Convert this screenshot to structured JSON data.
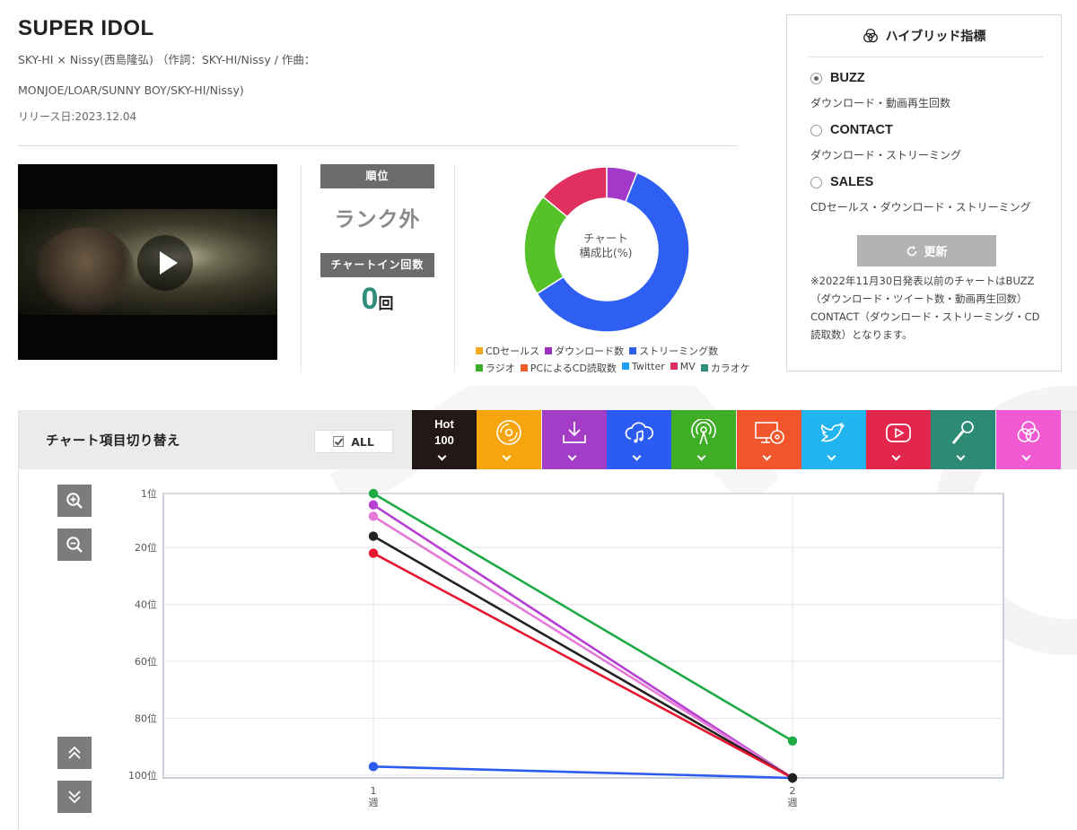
{
  "song": {
    "title": "SUPER IDOL",
    "credits_line1": "SKY-HI × Nissy(西島隆弘) （作詞：SKY-HI/Nissy / 作曲：",
    "credits_line2": "MONJOE/LOAR/SUNNY BOY/SKY-HI/Nissy)",
    "release": "リリース日:2023.12.04"
  },
  "stats": {
    "rank_label": "順位",
    "rank_value": "ランク外",
    "chartin_label": "チャートイン回数",
    "chartin_count": "0",
    "chartin_unit": "回"
  },
  "composition": {
    "center_line1": "チャート",
    "center_line2": "構成比(%)",
    "slices": [
      {
        "name": "ダウンロード数",
        "value": 6,
        "color": "#a23ac7"
      },
      {
        "name": "ストリーミング数",
        "value": 60,
        "color": "#2f5ff2"
      },
      {
        "name": "ラジオ",
        "value": 20,
        "color": "#55c22a"
      },
      {
        "name": "MV",
        "value": 14,
        "color": "#e0305f"
      }
    ],
    "legend_row1": [
      {
        "label": "CDセールス",
        "color": "#f5a623"
      },
      {
        "label": "ダウンロード数",
        "color": "#9b30c0"
      },
      {
        "label": "ストリーミング数",
        "color": "#2f5ff2"
      }
    ],
    "legend_row2": [
      {
        "label": "ラジオ",
        "color": "#3aaa2a"
      },
      {
        "label": "PCによるCD読取数",
        "color": "#f25a2a"
      },
      {
        "label": "Twitter",
        "color": "#1da1f2"
      },
      {
        "label": "MV",
        "color": "#e0305f"
      },
      {
        "label": "カラオケ",
        "color": "#2f8d79"
      }
    ]
  },
  "hybrid": {
    "heading": "ハイブリッド指標",
    "options": [
      {
        "label": "BUZZ",
        "desc": "ダウンロード・動画再生回数",
        "checked": true
      },
      {
        "label": "CONTACT",
        "desc": "ダウンロード・ストリーミング",
        "checked": false
      },
      {
        "label": "SALES",
        "desc": "CDセールス・ダウンロード・ストリーミング",
        "checked": false
      }
    ],
    "update_label": "更新",
    "note": "※2022年11月30日発表以前のチャートはBUZZ（ダウンロード・ツイート数・動画再生回数）CONTACT（ダウンロード・ストリーミング・CD読取数）となります。"
  },
  "switcher": {
    "label": "チャート項目切り替え",
    "all_label": "ALL",
    "tabs": [
      {
        "id": "hot100",
        "line1": "Hot",
        "line2": "100",
        "color": "#231815",
        "icon": "text"
      },
      {
        "id": "cd",
        "color": "#f6a50d",
        "icon": "cd-icon"
      },
      {
        "id": "download",
        "color": "#a33cc6",
        "icon": "download-icon"
      },
      {
        "id": "streaming",
        "color": "#2b5bf0",
        "icon": "cloud-music-icon"
      },
      {
        "id": "radio",
        "color": "#3fae26",
        "icon": "radio-icon"
      },
      {
        "id": "pc-cd",
        "color": "#f0552b",
        "icon": "pc-cd-icon"
      },
      {
        "id": "twitter",
        "color": "#22b4ef",
        "icon": "twitter-icon"
      },
      {
        "id": "mv",
        "color": "#e3264d",
        "icon": "youtube-icon"
      },
      {
        "id": "karaoke",
        "color": "#2d8a74",
        "icon": "microphone-icon"
      },
      {
        "id": "hybrid",
        "color": "#f05ad2",
        "icon": "hybrid-icon"
      }
    ]
  },
  "chart_data": {
    "type": "line",
    "x": [
      "1 週",
      "2 週"
    ],
    "y_ticks": [
      "1位",
      "20位",
      "40位",
      "60位",
      "80位",
      "100位"
    ],
    "y_tick_values": [
      1,
      20,
      40,
      60,
      80,
      100
    ],
    "ylim": [
      1,
      101
    ],
    "y_inverted": true,
    "series": [
      {
        "color": "#1faa46",
        "values": [
          1,
          88
        ]
      },
      {
        "color": "#b63fd2",
        "values": [
          5,
          101
        ]
      },
      {
        "color": "#e37ad8",
        "values": [
          9,
          101
        ]
      },
      {
        "color": "#222222",
        "values": [
          16,
          101
        ]
      },
      {
        "color": "#e6162f",
        "values": [
          22,
          101
        ]
      },
      {
        "color": "#2b5bf0",
        "values": [
          97,
          101
        ]
      }
    ]
  }
}
